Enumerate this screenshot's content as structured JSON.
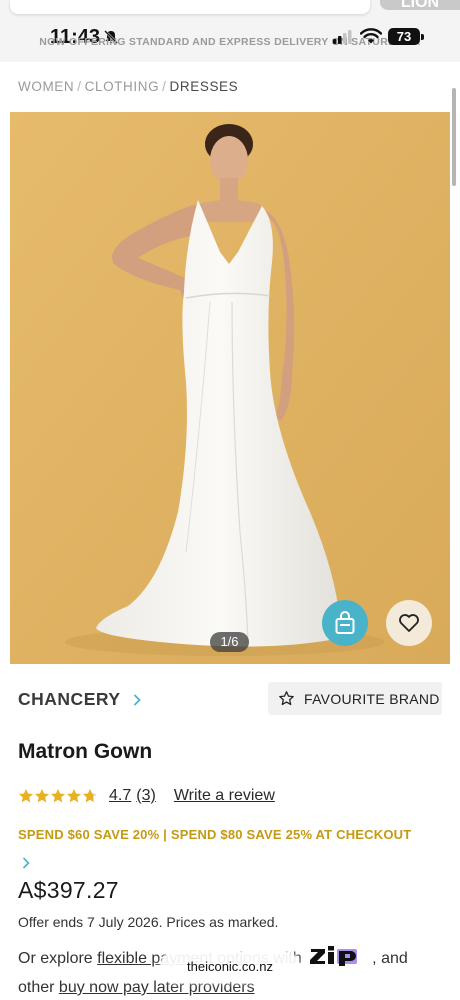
{
  "status_bar": {
    "time": "11:43",
    "battery": "73",
    "top_right_stub": "LION"
  },
  "promo_strip": "NOW OFFERING STANDARD AND EXPRESS DELIVERY ON SATURDAYS.",
  "breadcrumb": {
    "items": [
      "WOMEN",
      "CLOTHING",
      "DRESSES"
    ],
    "separator": "/"
  },
  "gallery": {
    "pager": "1/6",
    "background_color": "#e1b567"
  },
  "brand": {
    "name": "CHANCERY",
    "favourite_label": "FAVOURITE BRAND"
  },
  "product": {
    "name": "Matron Gown",
    "rating": {
      "value": "4.7",
      "count": "(3)",
      "stars": 4.7,
      "write_review": "Write a review"
    },
    "promo": "SPEND $60 SAVE 20% | SPEND $80 SAVE 25% AT CHECKOUT",
    "price": "A$397.27",
    "offer": "Offer ends 7 July 2026. Prices as marked.",
    "payment": {
      "prefix": "Or explore",
      "link1": "flexible payment options",
      "middle": "with",
      "zip_logo": "ZIP",
      "suffix": ", and other",
      "link2": "buy now pay later providers"
    }
  },
  "browser": {
    "url": "theiconic.co.nz"
  },
  "colors": {
    "accent_teal": "#49b3c9",
    "promo_gold": "#c59a13",
    "star_gold": "#e8b21e",
    "zip_purple": "#aa8ff0"
  }
}
